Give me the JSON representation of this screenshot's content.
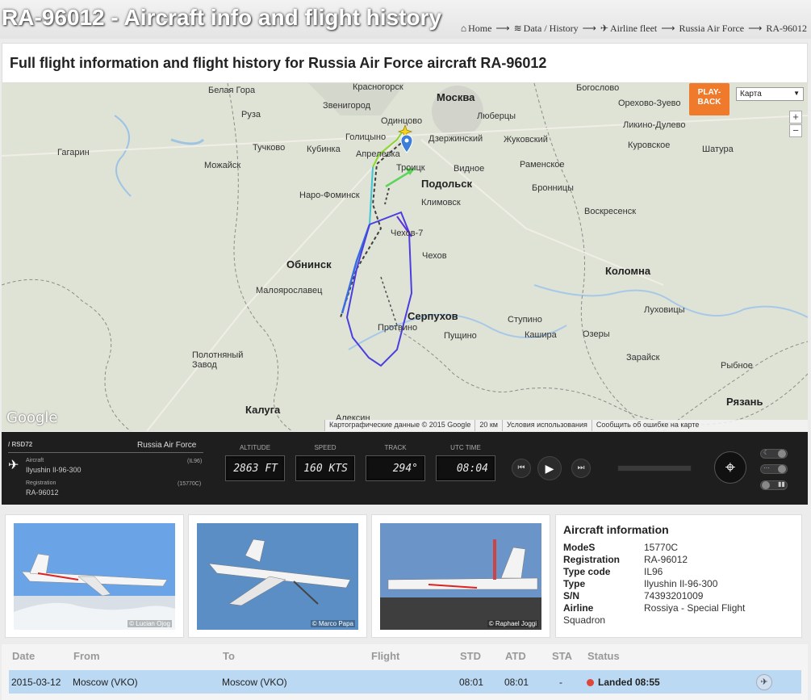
{
  "header": {
    "title": "RA-96012 - Aircraft info and flight history",
    "breadcrumbs": [
      "Home",
      "Data / History",
      "Airline fleet",
      "Russia Air Force",
      "RA-96012"
    ],
    "subtitle": "Full flight information and flight history for Russia Air Force aircraft RA-96012"
  },
  "map": {
    "playback_label": "PLAY-\nBACK",
    "map_type": "Карта",
    "zoom_in": "+",
    "zoom_out": "−",
    "google_logo": "Google",
    "attribution": [
      "Картографические данные © 2015 Google",
      "20 км",
      "Условия использования",
      "Сообщить об ошибке на карте"
    ],
    "places": [
      "Красногорск",
      "Москва",
      "Богослово",
      "Белая Гора",
      "Звенигород",
      "Люберцы",
      "Орехово-Зуево",
      "Руза",
      "Одинцово",
      "Ликино-Дулево",
      "Голицыно",
      "Дзержинский",
      "Жуковский",
      "Куровское",
      "Гагарин",
      "Тучково",
      "Кубинка",
      "Апрелевка",
      "Шатура",
      "Можайск",
      "Троицк",
      "Видное",
      "Раменское",
      "Подольск",
      "Бронницы",
      "Наро-Фоминск",
      "Климовск",
      "Воскресенск",
      "Чехов-7",
      "Обнинск",
      "Чехов",
      "Коломна",
      "Малоярославец",
      "Луховицы",
      "Серпухов",
      "Ступино",
      "Протвино",
      "Пущино",
      "Кашира",
      "Озеры",
      "Полотняный Завод",
      "Зарайск",
      "Рыбное",
      "Калуга",
      "Алексин",
      "Рязань"
    ]
  },
  "panel": {
    "callsign": "/ RSD72",
    "airline": "Russia Air Force",
    "aircraft_label": "Aircraft",
    "aircraft_value": "Ilyushin Il-96-300",
    "aircraft_code": "(IL96)",
    "registration_label": "Registration",
    "registration_value": "RA-96012",
    "registration_code": "(15770C)",
    "instruments": [
      {
        "label": "ALTITUDE",
        "value": "2863 FT"
      },
      {
        "label": "SPEED",
        "value": "160 KTS"
      },
      {
        "label": "TRACK",
        "value": "294°"
      },
      {
        "label": "UTC TIME",
        "value": "08:04"
      }
    ]
  },
  "photos": [
    {
      "credit": "© Lucian Ojog"
    },
    {
      "credit": "© Marco Papa"
    },
    {
      "credit": "© Raphael Joggi"
    }
  ],
  "aircraft_info": {
    "title": "Aircraft information",
    "rows": [
      {
        "k": "ModeS",
        "v": "15770C"
      },
      {
        "k": "Registration",
        "v": "RA-96012"
      },
      {
        "k": "Type code",
        "v": "IL96"
      },
      {
        "k": "Type",
        "v": "Ilyushin Il-96-300"
      },
      {
        "k": "S/N",
        "v": "74393201009"
      },
      {
        "k": "Airline",
        "v": "Rossiya - Special Flight"
      }
    ],
    "extra": "Squadron"
  },
  "history": {
    "headers": [
      "Date",
      "From",
      "To",
      "Flight",
      "STD",
      "ATD",
      "STA",
      "Status"
    ],
    "rows": [
      {
        "date": "2015-03-12",
        "from": "Moscow (VKO)",
        "to": "Moscow (VKO)",
        "flight": "",
        "std": "08:01",
        "atd": "08:01",
        "sta": "-",
        "status": "Landed 08:55"
      }
    ]
  },
  "colors": {
    "accent": "#f07a2c",
    "row_highlight": "#bcd9f3",
    "status_red": "#e0453a"
  }
}
